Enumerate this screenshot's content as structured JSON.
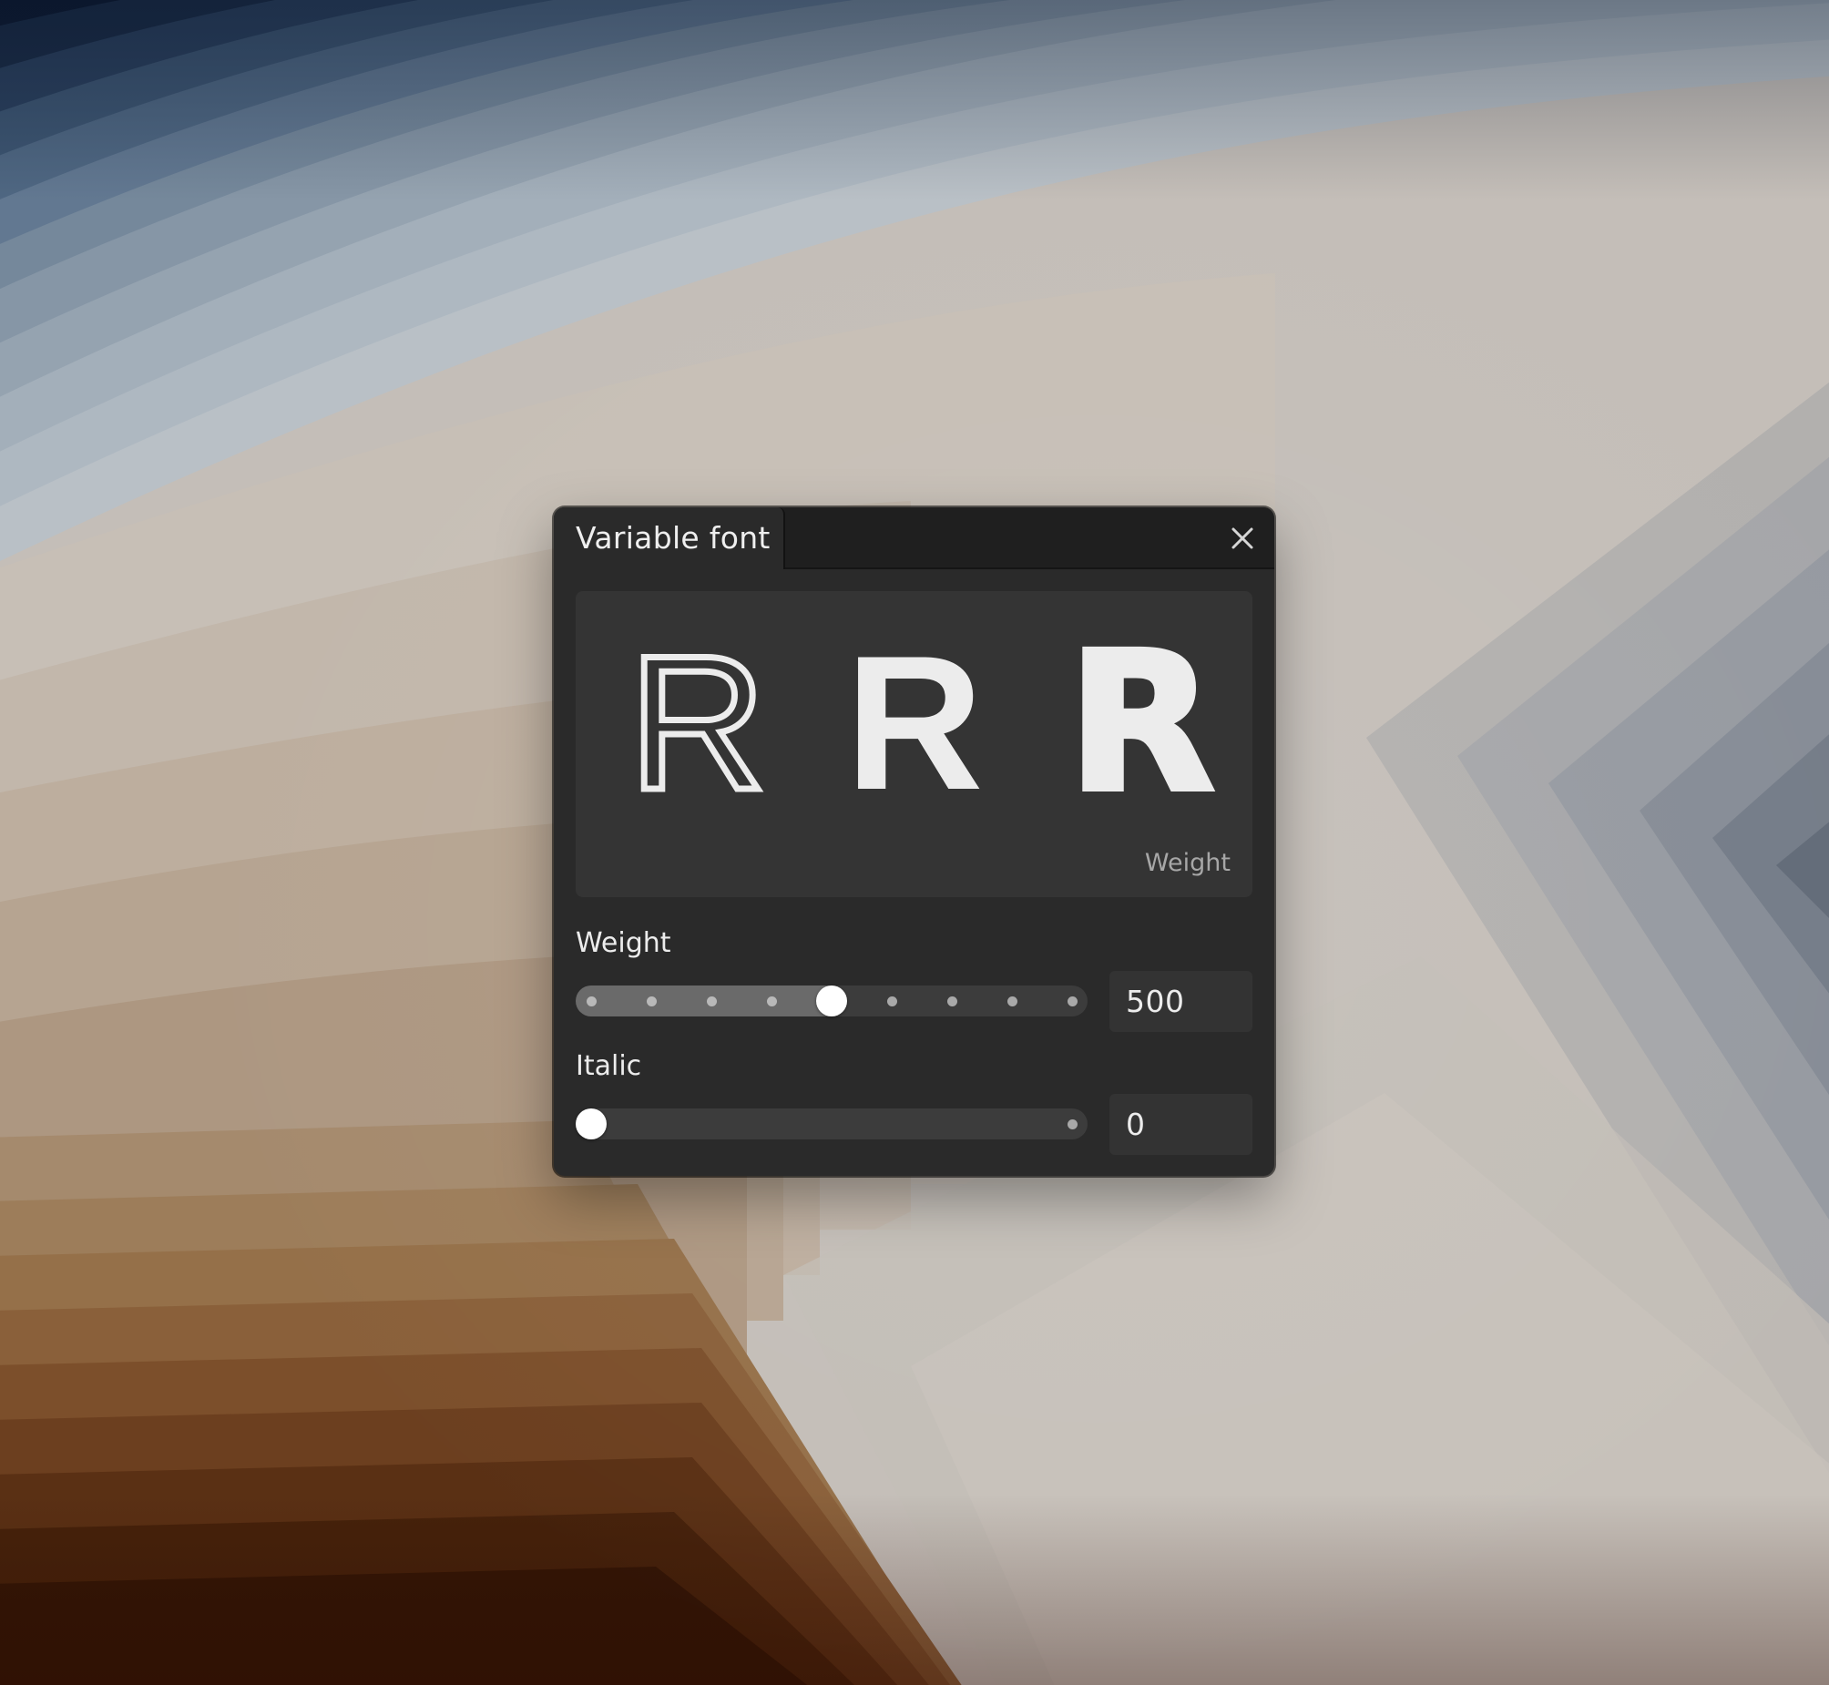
{
  "panel": {
    "title": "Variable font",
    "close_icon": "close-icon"
  },
  "preview": {
    "glyphs": [
      "R",
      "R",
      "R"
    ],
    "axis_label": "Weight"
  },
  "axes": {
    "weight": {
      "label": "Weight",
      "value": "500",
      "numeric_value": 500,
      "min": 100,
      "max": 900,
      "ticks": [
        100,
        200,
        300,
        400,
        500,
        600,
        700,
        800,
        900
      ]
    },
    "italic": {
      "label": "Italic",
      "value": "0",
      "numeric_value": 0,
      "min": 0,
      "max": 1,
      "ticks": [
        0,
        1
      ]
    }
  },
  "colors": {
    "panel_bg": "#2a2a2a",
    "titlebar_bg": "#1f1f1f",
    "preview_bg": "#343434",
    "text": "#ececec",
    "muted_text": "#a7a7a7",
    "slider_track": "#3c3c3c",
    "slider_fill": "#6a6a6a",
    "thumb": "#ffffff"
  }
}
